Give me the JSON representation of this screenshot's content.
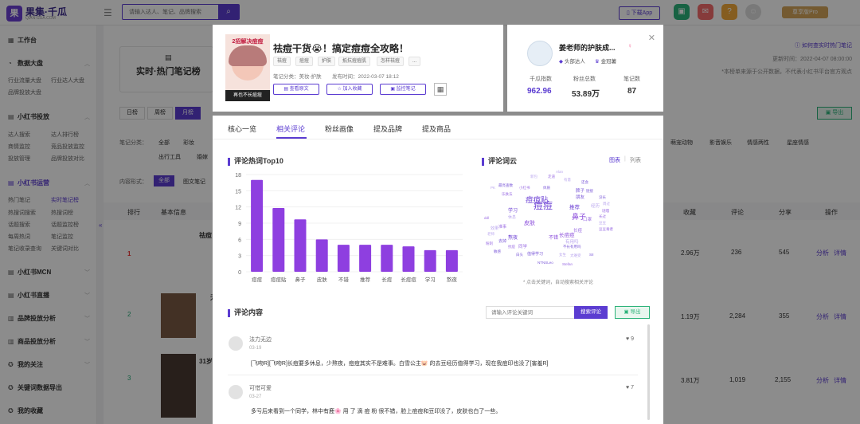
{
  "brand": {
    "name": "果集·千瓜",
    "sub": "QIAN-GUA.COM"
  },
  "search": {
    "placeholder": "请输入达人、笔记、品牌搜索"
  },
  "topbar": {
    "download_label": "下载App",
    "pro_label": "尊享版Pro"
  },
  "sidebar": {
    "workbench": "工作台",
    "sections": [
      {
        "title": "数据大盘",
        "items": [
          "行业流量大盘",
          "行业达人大盘",
          "品牌投放大盘"
        ]
      },
      {
        "title": "小红书投放",
        "items": [
          "达人搜索",
          "达人排行榜",
          "商情监控",
          "竞品投放监控",
          "投放管理",
          "品牌投放对比"
        ]
      },
      {
        "title": "小红书运营",
        "items": [
          "热门笔记",
          "实时笔记榜",
          "热搜词搜索",
          "热搜词榜",
          "话题搜索",
          "话题监控榜",
          "每周热词",
          "笔记监控",
          "笔记收录查询",
          "关键词对比"
        ]
      },
      {
        "title": "小红书MCN",
        "items": []
      },
      {
        "title": "小红书直播",
        "items": []
      },
      {
        "title": "品牌投放分析",
        "items": []
      },
      {
        "title": "商品投放分析",
        "items": []
      },
      {
        "title": "我的关注",
        "items": []
      },
      {
        "title": "关键词数据导出",
        "items": []
      },
      {
        "title": "我的收藏",
        "items": []
      }
    ]
  },
  "bg": {
    "page_title": "实时·热门笔记榜",
    "help": "如何查实时热门笔记",
    "update": "更新时间：2022-04-07 08:00:00",
    "note": "*本榜单来源于公开数据，不代表小红书平台官方观点",
    "periods": [
      "日榜",
      "周榜",
      "月榜"
    ],
    "category_label": "笔记分类：",
    "categories": [
      "全部",
      "彩妆",
      "出行工具",
      "婚嫁",
      "萌宠动物",
      "影音娱乐",
      "情感两性",
      "星座情感"
    ],
    "form_label": "内容形式：",
    "forms": [
      "全部",
      "图文笔记"
    ],
    "export": "导出",
    "columns": [
      "排行",
      "基本信息",
      "收藏",
      "评论",
      "分享",
      "操作"
    ],
    "rows": [
      {
        "rank": "1",
        "name": "祛痘",
        "fav": "2.96万",
        "cmt": "236",
        "share": "545"
      },
      {
        "rank": "2",
        "name": "无",
        "fav": "1.19万",
        "cmt": "2,284",
        "share": "355"
      },
      {
        "rank": "3",
        "name": "31岁",
        "fav": "3.81万",
        "cmt": "1,019",
        "share": "2,155"
      }
    ],
    "ops": [
      "分析",
      "详情"
    ]
  },
  "note": {
    "thumb_text_top": "2招解决痘痘",
    "thumb_text_bottom": "再也不长痘痘",
    "title": "祛痘干货😭！搞定痘痘全攻略！",
    "tags": [
      "祛痘",
      "痘痘",
      "护肤",
      "抵抗痘痘肌",
      "怎样祛痘",
      "..."
    ],
    "category": "笔记分类：美妆-护肤",
    "publish": "发布时间：2022-03-07 18:12",
    "buttons": [
      "查看原文",
      "加入收藏",
      "监控笔记"
    ]
  },
  "author": {
    "name": "姜老师的护肤成...",
    "badges": [
      "头部达人",
      "金冠薯"
    ],
    "stats": [
      {
        "label": "千瓜指数",
        "value": "962.96"
      },
      {
        "label": "粉丝总数",
        "value": "53.89万"
      },
      {
        "label": "笔记数",
        "value": "87"
      }
    ]
  },
  "detail_tabs": [
    "核心一览",
    "相关评论",
    "粉丝画像",
    "提及品牌",
    "提及商品"
  ],
  "chart_data": {
    "type": "bar",
    "title": "评论热词Top10",
    "categories": [
      "痘痘",
      "痘痘贴",
      "鼻子",
      "皮肤",
      "不错",
      "推荐",
      "长痘",
      "长痘痘",
      "学习",
      "熬夜"
    ],
    "values": [
      17,
      11.8,
      9.7,
      6,
      5,
      5,
      5,
      4.7,
      4,
      4
    ],
    "ylim": [
      0,
      18
    ],
    "yticks": [
      0,
      3,
      6,
      9,
      12,
      15,
      18
    ],
    "color": "#8e3fe0"
  },
  "wordcloud": {
    "title": "评论词云",
    "views": [
      "图表",
      "列表"
    ],
    "hint": "* 点击关键词，自动搜索相关评论",
    "words": [
      {
        "t": "痘痘",
        "s": 20
      },
      {
        "t": "鼻子",
        "s": 14
      },
      {
        "t": "痘痘贴",
        "s": 15
      },
      {
        "t": "皮肤",
        "s": 10
      },
      {
        "t": "推荐",
        "s": 9
      },
      {
        "t": "长痘痘",
        "s": 9
      },
      {
        "t": "熬夜",
        "s": 8
      },
      {
        "t": "不错",
        "s": 8
      },
      {
        "t": "学习",
        "s": 8
      },
      {
        "t": "长痘",
        "s": 7
      },
      {
        "t": "朋友",
        "s": 7
      },
      {
        "t": "经历",
        "s": 7
      },
      {
        "t": "口罩",
        "s": 7
      },
      {
        "t": "脾子",
        "s": 7
      },
      {
        "t": "有用吗",
        "s": 7
      },
      {
        "t": "同学",
        "s": 7
      },
      {
        "t": "值得学习",
        "s": 6
      },
      {
        "t": "休息",
        "s": 6
      },
      {
        "t": "准事",
        "s": 6
      },
      {
        "t": "去掉",
        "s": 6
      },
      {
        "t": "效果",
        "s": 6
      },
      {
        "t": "抗痘",
        "s": 5
      },
      {
        "t": "白头",
        "s": 5
      },
      {
        "t": "女生",
        "s": 5
      },
      {
        "t": "小红书",
        "s": 5
      },
      {
        "t": "体质",
        "s": 5
      },
      {
        "t": "有意",
        "s": 5
      },
      {
        "t": "乐肤法",
        "s": 5
      },
      {
        "t": "最亮查数",
        "s": 5
      },
      {
        "t": "新包",
        "s": 5
      },
      {
        "t": "走道",
        "s": 5
      },
      {
        "t": "还会",
        "s": 5
      },
      {
        "t": "豆豆",
        "s": 5
      },
      {
        "t": "豆豆毒者",
        "s": 5
      },
      {
        "t": "不长有用吗",
        "s": 5
      },
      {
        "t": "太难受",
        "s": 5
      },
      {
        "t": "谜嘎",
        "s": 5
      },
      {
        "t": "没长",
        "s": 5
      },
      {
        "t": "周过",
        "s": 5
      },
      {
        "t": "长过",
        "s": 5
      },
      {
        "t": "链接",
        "s": 5
      },
      {
        "t": "老师",
        "s": 5
      },
      {
        "t": "粉刺",
        "s": 5
      },
      {
        "t": "敏感",
        "s": 5
      },
      {
        "t": "Alan",
        "s": 5
      },
      {
        "t": "Stefan",
        "s": 5
      },
      {
        "t": "NTNSLeo",
        "s": 5
      },
      {
        "t": "PK",
        "s": 5
      },
      {
        "t": "ddl",
        "s": 5
      },
      {
        "t": "SII",
        "s": 5
      }
    ]
  },
  "comments": {
    "title": "评论内容",
    "placeholder": "请输入评论关键词",
    "search_btn": "搜索评论",
    "export": "导出",
    "items": [
      {
        "user": "法力无边",
        "date": "03-19",
        "likes": "9",
        "text": "[飞吻R][飞吻R]长痘要多休息，少熬夜，痘痘其实不是难事。白雪公主🐷 的去豆经历值得学习，现在我痘印也没了[害羞R]"
      },
      {
        "user": "可惜可爱",
        "date": "03-27",
        "likes": "7",
        "text": "多亏后来看到一个同学，林中有鹿🌸 用 了 滴 痘 粉 很不错，脸上痘痘和豆印没了，皮肤也白了一些。"
      }
    ]
  }
}
